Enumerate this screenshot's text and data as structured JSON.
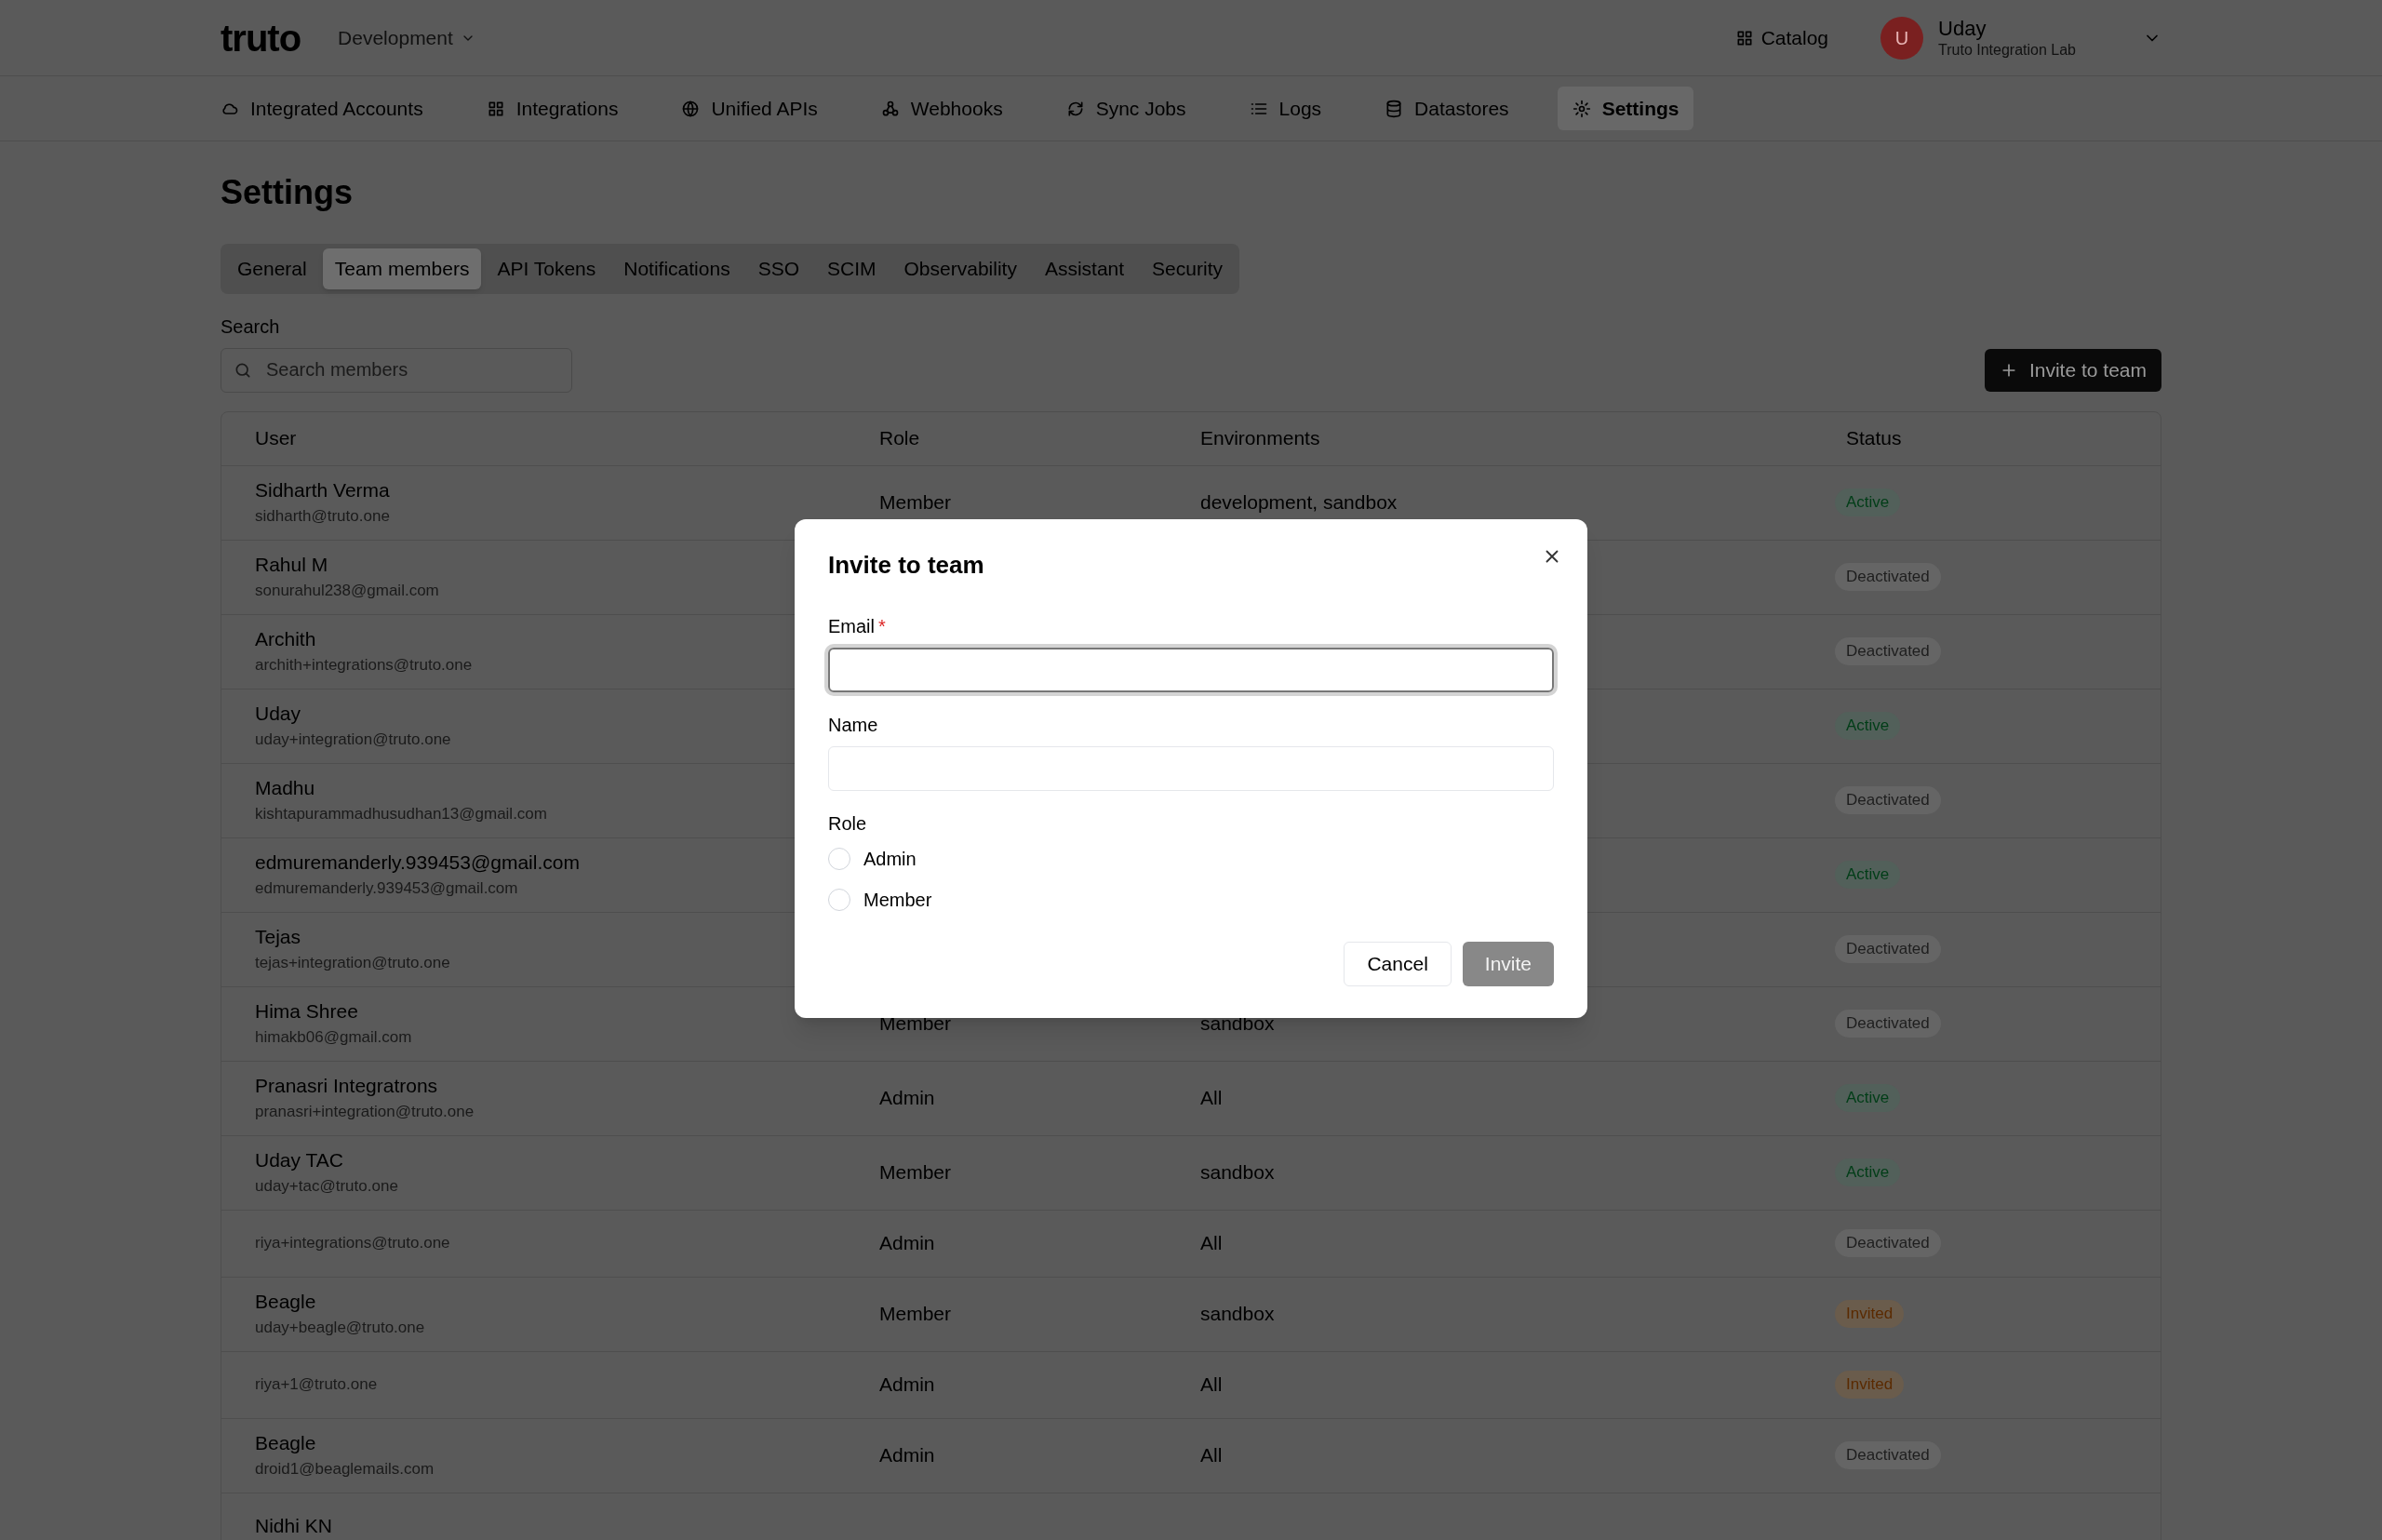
{
  "header": {
    "logo": "truto",
    "environment": "Development",
    "catalog": "Catalog",
    "user": {
      "initial": "U",
      "name": "Uday",
      "org": "Truto Integration Lab"
    }
  },
  "nav": [
    {
      "label": "Integrated Accounts",
      "selected": false
    },
    {
      "label": "Integrations",
      "selected": false
    },
    {
      "label": "Unified APIs",
      "selected": false
    },
    {
      "label": "Webhooks",
      "selected": false
    },
    {
      "label": "Sync Jobs",
      "selected": false
    },
    {
      "label": "Logs",
      "selected": false
    },
    {
      "label": "Datastores",
      "selected": false
    },
    {
      "label": "Settings",
      "selected": true
    }
  ],
  "page_title": "Settings",
  "tabs": [
    {
      "label": "General",
      "selected": false
    },
    {
      "label": "Team members",
      "selected": true
    },
    {
      "label": "API Tokens",
      "selected": false
    },
    {
      "label": "Notifications",
      "selected": false
    },
    {
      "label": "SSO",
      "selected": false
    },
    {
      "label": "SCIM",
      "selected": false
    },
    {
      "label": "Observability",
      "selected": false
    },
    {
      "label": "Assistant",
      "selected": false
    },
    {
      "label": "Security",
      "selected": false
    }
  ],
  "search": {
    "label": "Search",
    "placeholder": "Search members"
  },
  "invite_button": "Invite to team",
  "table": {
    "columns": [
      "User",
      "Role",
      "Environments",
      "Status"
    ],
    "rows": [
      {
        "name": "Sidharth Verma",
        "email": "sidharth@truto.one",
        "role": "Member",
        "environments": "development, sandbox",
        "status": "Active",
        "kind": "active"
      },
      {
        "name": "Rahul M",
        "email": "sonurahul238@gmail.com",
        "status": "Deactivated",
        "kind": "deactivated"
      },
      {
        "name": "Archith",
        "email": "archith+integrations@truto.one",
        "status": "Deactivated",
        "kind": "deactivated"
      },
      {
        "name": "Uday",
        "email": "uday+integration@truto.one",
        "status": "Active",
        "kind": "active"
      },
      {
        "name": "Madhu",
        "email": "kishtapurammadhusudhan13@gmail.com",
        "status": "Deactivated",
        "kind": "deactivated"
      },
      {
        "name": "edmuremanderly.939453@gmail.com",
        "email": "edmuremanderly.939453@gmail.com",
        "status": "Active",
        "kind": "active"
      },
      {
        "name": "Tejas",
        "email": "tejas+integration@truto.one",
        "status": "Deactivated",
        "kind": "deactivated"
      },
      {
        "name": "Hima Shree",
        "email": "himakb06@gmail.com",
        "role": "Member",
        "environments": "sandbox",
        "status": "Deactivated",
        "kind": "deactivated"
      },
      {
        "name": "Pranasri Integratrons",
        "email": "pranasri+integration@truto.one",
        "role": "Admin",
        "environments": "All",
        "status": "Active",
        "kind": "active"
      },
      {
        "name": "Uday TAC",
        "email": "uday+tac@truto.one",
        "role": "Member",
        "environments": "sandbox",
        "status": "Active",
        "kind": "active"
      },
      {
        "email": "riya+integrations@truto.one",
        "role": "Admin",
        "environments": "All",
        "status": "Deactivated",
        "kind": "deactivated"
      },
      {
        "name": "Beagle",
        "email": "uday+beagle@truto.one",
        "role": "Member",
        "environments": "sandbox",
        "status": "Invited",
        "kind": "invited"
      },
      {
        "email": "riya+1@truto.one",
        "role": "Admin",
        "environments": "All",
        "status": "Invited",
        "kind": "invited"
      },
      {
        "name": "Beagle",
        "email": "droid1@beaglemails.com",
        "role": "Admin",
        "environments": "All",
        "status": "Deactivated",
        "kind": "deactivated"
      },
      {
        "name": "Nidhi KN"
      }
    ]
  },
  "dialog": {
    "title": "Invite to team",
    "email_label": "Email",
    "required_mark": "*",
    "name_label": "Name",
    "role_label": "Role",
    "roles": [
      {
        "label": "Admin",
        "selected": false
      },
      {
        "label": "Member",
        "selected": false
      }
    ],
    "cancel": "Cancel",
    "invite": "Invite",
    "invite_disabled": true
  }
}
